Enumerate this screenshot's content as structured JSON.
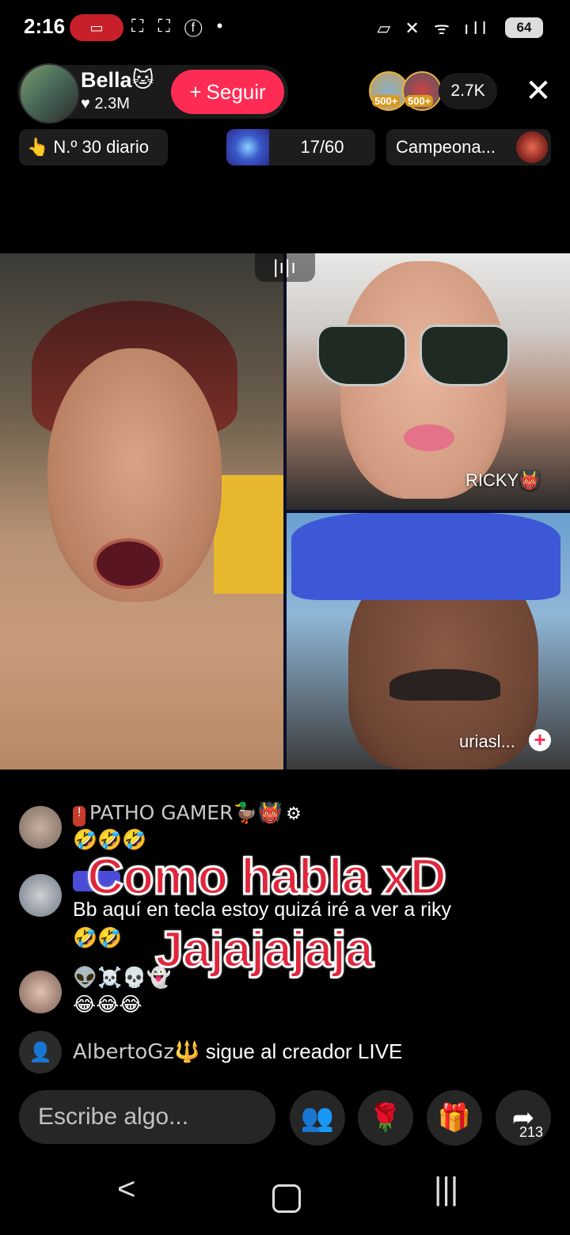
{
  "status_bar": {
    "time": "2:16",
    "left_icons": "⛶ ⛶ ⓕ •",
    "right_icons": "▱ ✕ ᯤ ıll",
    "battery": "64"
  },
  "host": {
    "name": "Bella🐱",
    "likes": "♥ 2.3M",
    "follow_label": "Seguir",
    "follow_plus": "+"
  },
  "viewers": {
    "badge1": "500+",
    "badge2": "500+",
    "count": "2.7K"
  },
  "chips": {
    "rank": "N.º 30 diario",
    "rank_icon": "👆",
    "goal_progress": "17/60",
    "campaign": "Campeona..."
  },
  "participants": {
    "top_right_name": "RICKY👹",
    "bottom_right_name": "uriasl..."
  },
  "comments": [
    {
      "user": "PATHO GAMER🦆👹",
      "prefix": "👹🦆",
      "text": "🤣🤣🤣"
    },
    {
      "user": "",
      "text": "Bb aquí en tecla estoy quizá iré a ver a riky",
      "text2": "🤣🤣"
    },
    {
      "user": "👽☠️💀👻",
      "text": "😂😂😂"
    }
  ],
  "overlay_caption": {
    "line1": "Como habla xD",
    "line2": "Jajajajaja"
  },
  "follow_notice": {
    "user": "AlbertoGz🔱",
    "text": "sigue al creador LIVE"
  },
  "bottom_bar": {
    "input_placeholder": "Escribe algo...",
    "share_count": "213"
  },
  "icons": {
    "close": "close-icon",
    "share": "share-icon",
    "gift": "gift-icon",
    "rose": "rose-icon",
    "guests": "guests-icon"
  },
  "colors": {
    "accent": "#fe2c55",
    "caption_red": "#e0263c"
  }
}
